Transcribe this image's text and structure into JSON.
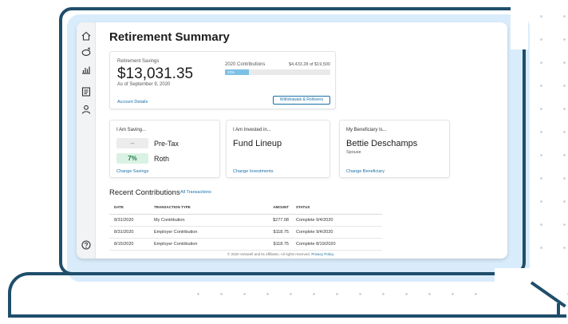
{
  "nav": {
    "items": [
      {
        "name": "home",
        "icon": "home-icon"
      },
      {
        "name": "piggy-bank",
        "icon": "piggy-bank-icon"
      },
      {
        "name": "chart",
        "icon": "bar-chart-icon"
      },
      {
        "name": "documents",
        "icon": "document-icon"
      },
      {
        "name": "profile",
        "icon": "user-icon"
      },
      {
        "name": "help",
        "icon": "help-icon"
      }
    ]
  },
  "page": {
    "title": "Retirement Summary"
  },
  "savings": {
    "label": "Retirement Savings",
    "amount": "$13,031.35",
    "as_of": "As of September 9, 2020",
    "contributions_label": "2020 Contributions",
    "contributions_value": "$4,433.28 of $19,500",
    "progress_text": "23%",
    "progress_fraction": 0.23,
    "details_link": "Account Details",
    "withdraw_button": "Withdrawals & Rollovers"
  },
  "saving_card": {
    "title": "I Am Saving...",
    "rows": [
      {
        "value": "--",
        "label": "Pre-Tax",
        "active": false
      },
      {
        "value": "7%",
        "label": "Roth",
        "active": true
      }
    ],
    "link": "Change Savings"
  },
  "invested_card": {
    "title": "I Am Invested in...",
    "value": "Fund Lineup",
    "link": "Change Investments"
  },
  "beneficiary_card": {
    "title": "My Beneficiary Is...",
    "name": "Bettie Deschamps",
    "relation": "Spouse",
    "link": "Change Beneficiary"
  },
  "recent": {
    "title": "Recent Contributions",
    "all_link": "All Transactions",
    "columns": [
      "DATE",
      "TRANSACTION TYPE",
      "AMOUNT",
      "STATUS"
    ],
    "rows": [
      {
        "date": "8/31/2020",
        "type": "My Contribution",
        "amount": "$277.08",
        "status": "Complete 9/4/2020"
      },
      {
        "date": "8/31/2020",
        "type": "Employer Contribution",
        "amount": "$118.75",
        "status": "Complete 9/4/2020"
      },
      {
        "date": "8/15/2020",
        "type": "Employer Contribution",
        "amount": "$118.75",
        "status": "Complete 8/19/2020"
      }
    ]
  },
  "footer": {
    "text": "© 2020 Vestwell and its affiliates. All rights reserved.",
    "privacy_link": "Privacy Policy"
  },
  "colors": {
    "accent": "#1b6fa8",
    "frame": "#1f4e6b",
    "progress": "#7cc0e6",
    "screen_bg": "#d9ecfb"
  }
}
